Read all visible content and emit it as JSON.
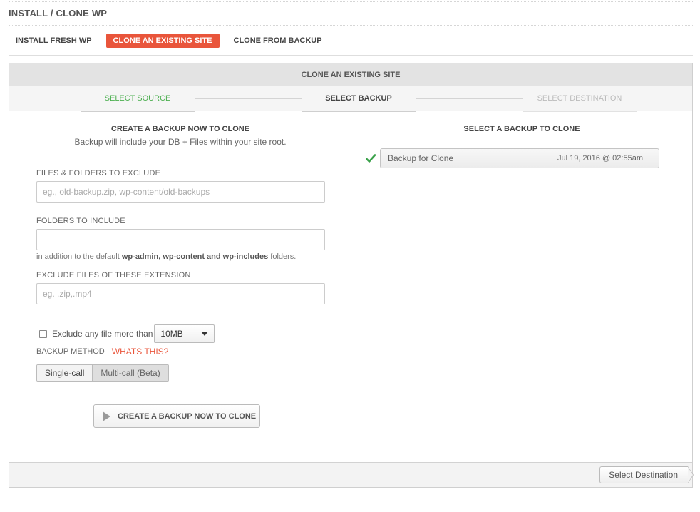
{
  "page": {
    "title": "INSTALL / CLONE WP"
  },
  "tabs": [
    {
      "label": "INSTALL FRESH WP",
      "active": false
    },
    {
      "label": "CLONE AN EXISTING SITE",
      "active": true
    },
    {
      "label": "CLONE FROM BACKUP",
      "active": false
    }
  ],
  "panel": {
    "header": "CLONE AN EXISTING SITE",
    "steps": [
      {
        "label": "SELECT SOURCE",
        "state": "done"
      },
      {
        "label": "SELECT BACKUP",
        "state": "current"
      },
      {
        "label": "SELECT DESTINATION",
        "state": "pending"
      }
    ]
  },
  "create": {
    "title": "CREATE A BACKUP NOW TO CLONE",
    "subtitle": "Backup will include your DB + Files within your site root.",
    "exclude_label": "FILES & FOLDERS TO EXCLUDE",
    "exclude_placeholder": "eg., old-backup.zip, wp-content/old-backups",
    "include_label": "FOLDERS TO INCLUDE",
    "include_value": "",
    "include_hint_prefix": "in addition to the default ",
    "include_hint_bold": "wp-admin, wp-content and wp-includes",
    "include_hint_suffix": " folders.",
    "ext_label": "EXCLUDE FILES OF THESE EXTENSION",
    "ext_placeholder": "eg. .zip,.mp4",
    "size_check_label": "Exclude any file more than",
    "size_check_checked": false,
    "size_value": "10MB",
    "method_label": "BACKUP METHOD",
    "whats_this": "WHATS THIS?",
    "method_single": "Single-call",
    "method_multi": "Multi-call (Beta)",
    "method_selected": "Multi-call (Beta)",
    "button_label": "CREATE A BACKUP NOW TO CLONE"
  },
  "select": {
    "title": "SELECT A BACKUP TO CLONE",
    "backups": [
      {
        "name": "Backup for Clone",
        "date": "Jul 19, 2016 @ 02:55am",
        "selected": true
      }
    ]
  },
  "footer": {
    "next_label": "Select Destination"
  },
  "colors": {
    "accent": "#e9553b",
    "success": "#4caf50"
  }
}
